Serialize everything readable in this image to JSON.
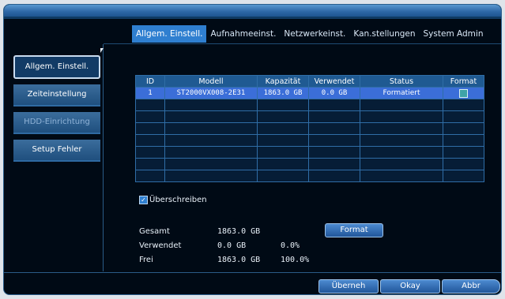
{
  "tabs": [
    {
      "label": "Allgem. Einstell.",
      "active": true
    },
    {
      "label": "Aufnahmeeinst.",
      "active": false
    },
    {
      "label": "Netzwerkeinst.",
      "active": false
    },
    {
      "label": "Kan.stellungen",
      "active": false
    },
    {
      "label": "System Admin",
      "active": false
    }
  ],
  "sidebar": {
    "items": [
      {
        "label": "Allgem. Einstell."
      },
      {
        "label": "Zeiteinstellung"
      },
      {
        "label": "HDD-Einrichtung"
      },
      {
        "label": "Setup Fehler"
      }
    ]
  },
  "table": {
    "headers": [
      "ID",
      "Modell",
      "Kapazität",
      "Verwendet",
      "Status",
      "Format"
    ],
    "row": {
      "id": "1",
      "model": "ST2000VX008-2E31",
      "capacity": "1863.0 GB",
      "used": "0.0 GB",
      "status": "Formatiert"
    }
  },
  "overwrite": {
    "label": "Überschreiben",
    "checked": true
  },
  "stats": {
    "total_label": "Gesamt",
    "total_value": "1863.0 GB",
    "used_label": "Verwendet",
    "used_value": "0.0 GB",
    "used_pct": "0.0%",
    "free_label": "Frei",
    "free_value": "1863.0 GB",
    "free_pct": "100.0%"
  },
  "buttons": {
    "format": "Format",
    "apply": "Überneh",
    "ok": "Okay",
    "cancel": "Abbr"
  },
  "colors": {
    "accent": "#2f7fd0",
    "background": "#000a15",
    "selected_row": "#3b6ed8"
  }
}
